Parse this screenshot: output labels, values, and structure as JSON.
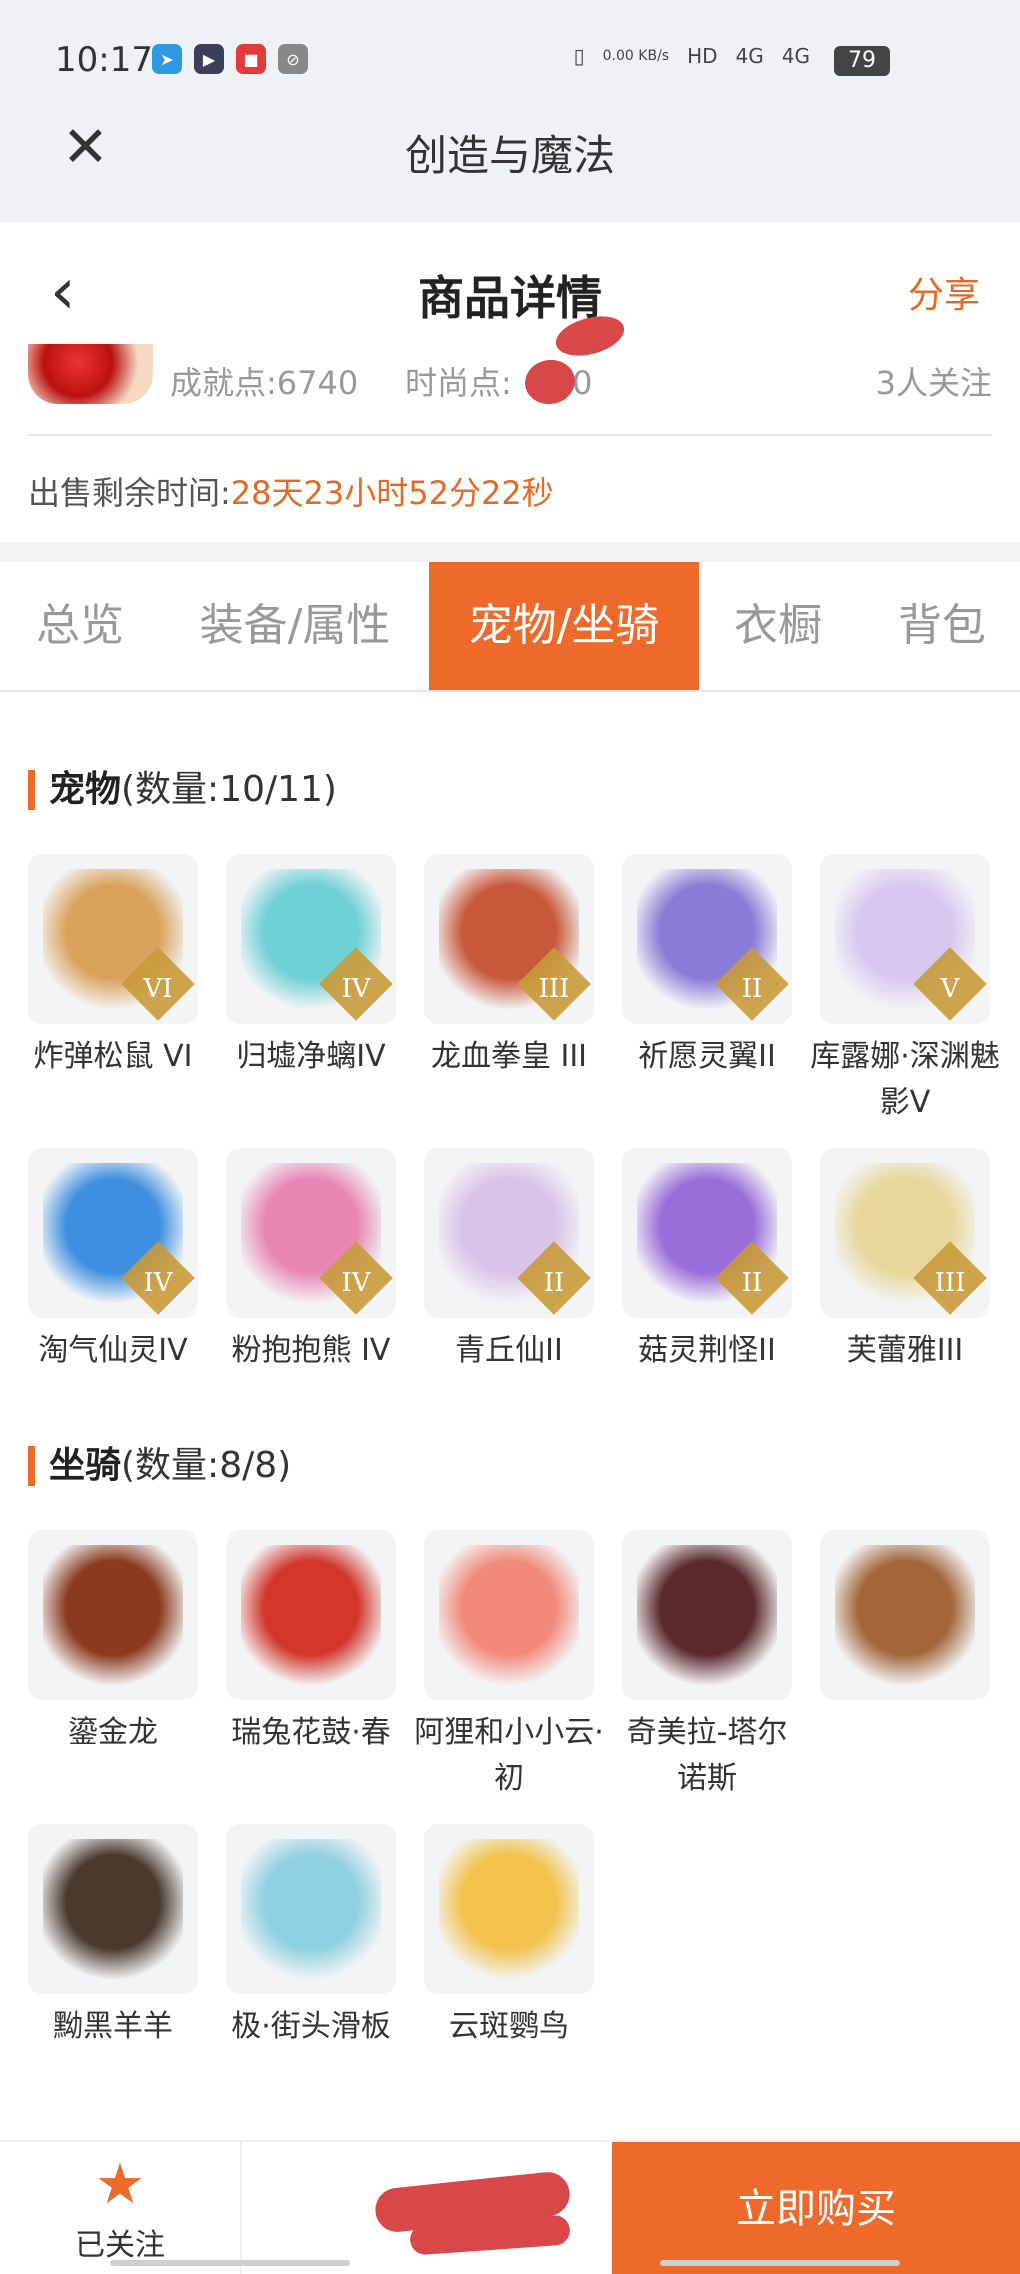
{
  "status_bar": {
    "time": "10:17",
    "net_speed": "0.00 KB/s",
    "signal1": "4G",
    "signal2": "4G",
    "battery": "79"
  },
  "app_header": {
    "title": "创造与魔法"
  },
  "page_header": {
    "title": "商品详情",
    "share_label": "分享"
  },
  "info": {
    "achievement": "成就点:6740",
    "fashion": "时尚点:",
    "fashion_tail": "40",
    "followers": "3人关注",
    "remain_label": "出售剩余时间:",
    "remain_value": "28天23小时52分22秒"
  },
  "tabs": [
    "总览",
    "装备/属性",
    "宠物/坐骑",
    "衣橱",
    "背包"
  ],
  "active_tab_index": 2,
  "pets": {
    "title": "宠物",
    "count": "(数量:10/11)",
    "items": [
      {
        "name": "炸弹松鼠 VI",
        "badge": "VI",
        "color": "#d9a35c"
      },
      {
        "name": "归墟净螭IV",
        "badge": "IV",
        "color": "#6fd0d6"
      },
      {
        "name": "龙血拳皇 III",
        "badge": "III",
        "color": "#c8583a"
      },
      {
        "name": "祈愿灵翼II",
        "badge": "II",
        "color": "#8a7bd6"
      },
      {
        "name": "库露娜·深渊魅影V",
        "badge": "V",
        "color": "#d8c8f0"
      },
      {
        "name": "淘气仙灵IV",
        "badge": "IV",
        "color": "#3f8fe0"
      },
      {
        "name": "粉抱抱熊 IV",
        "badge": "IV",
        "color": "#e887b3"
      },
      {
        "name": "青丘仙II",
        "badge": "II",
        "color": "#d9c3e8"
      },
      {
        "name": "菇灵荆怪II",
        "badge": "II",
        "color": "#9a6ed8"
      },
      {
        "name": "芙蕾雅III",
        "badge": "III",
        "color": "#e7d79a"
      }
    ]
  },
  "mounts": {
    "title": "坐骑",
    "count": "(数量:8/8)",
    "items": [
      {
        "name": "鎏金龙",
        "color": "#8a3a1e"
      },
      {
        "name": "瑞兔花鼓·春",
        "color": "#d2352a"
      },
      {
        "name": "阿狸和小小云·初",
        "color": "#f28a7a"
      },
      {
        "name": "奇美拉-塔尔诺斯",
        "color": "#5a2a2a"
      },
      {
        "name": "",
        "color": "#a2663a"
      },
      {
        "name": "黝黑羊羊",
        "color": "#4a3a2e"
      },
      {
        "name": "极·街头滑板",
        "color": "#8fd0e0"
      },
      {
        "name": "云斑鹦鸟",
        "color": "#f2c24a"
      }
    ]
  },
  "bottom_bar": {
    "follow_label": "已关注",
    "buy_label": "立即购买"
  }
}
